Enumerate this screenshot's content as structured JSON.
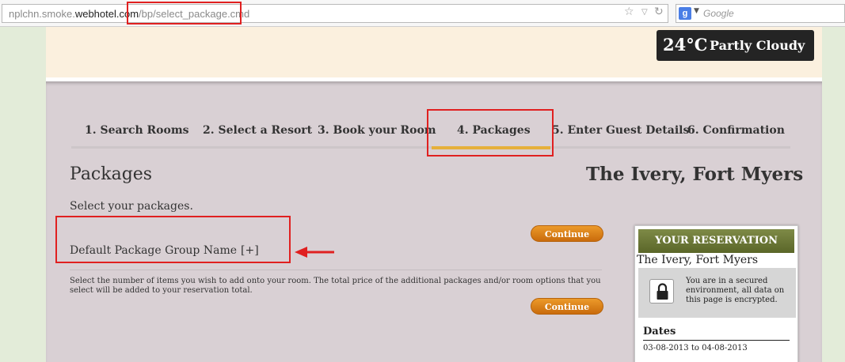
{
  "browser": {
    "url_prefix": "nplchn.smoke.",
    "url_domain": "webhotel.com",
    "url_path": "/bp/select_package.cmd",
    "search_placeholder": "Google",
    "search_engine_glyph": "g"
  },
  "header": {
    "weather_temp": "24°C",
    "weather_condition": "Partly Cloudy"
  },
  "steps": [
    {
      "label": "1.  Search Rooms",
      "active": false
    },
    {
      "label": "2.  Select a Resort",
      "active": false
    },
    {
      "label": "3.  Book your Room",
      "active": false
    },
    {
      "label": "4.  Packages",
      "active": true
    },
    {
      "label": "5.  Enter Guest Details",
      "active": false
    },
    {
      "label": "6.  Confirmation",
      "active": false
    }
  ],
  "page": {
    "title": "Packages",
    "hotel_name": "The Ivery, Fort Myers",
    "subtitle": "Select your packages.",
    "package_group": "Default Package Group Name",
    "expand_label": "[+]",
    "continue_label": "Continue",
    "description": "Select the number of items you wish to add onto your room. The total price of the additional packages and/or room options that you select will be added to your reservation total."
  },
  "reservation": {
    "heading": "YOUR RESERVATION",
    "hotel": "The Ivery, Fort Myers",
    "secure_text": "You are in a secured environment, all data on this page is encrypted.",
    "dates_label": "Dates",
    "check_in": "03-08-2013",
    "to_label": "to",
    "check_out": "04-08-2013"
  },
  "colors": {
    "annotation": "#e02020",
    "active_step": "#e6b03b",
    "button": "#d9800f",
    "panel_header": "#6b7735"
  }
}
